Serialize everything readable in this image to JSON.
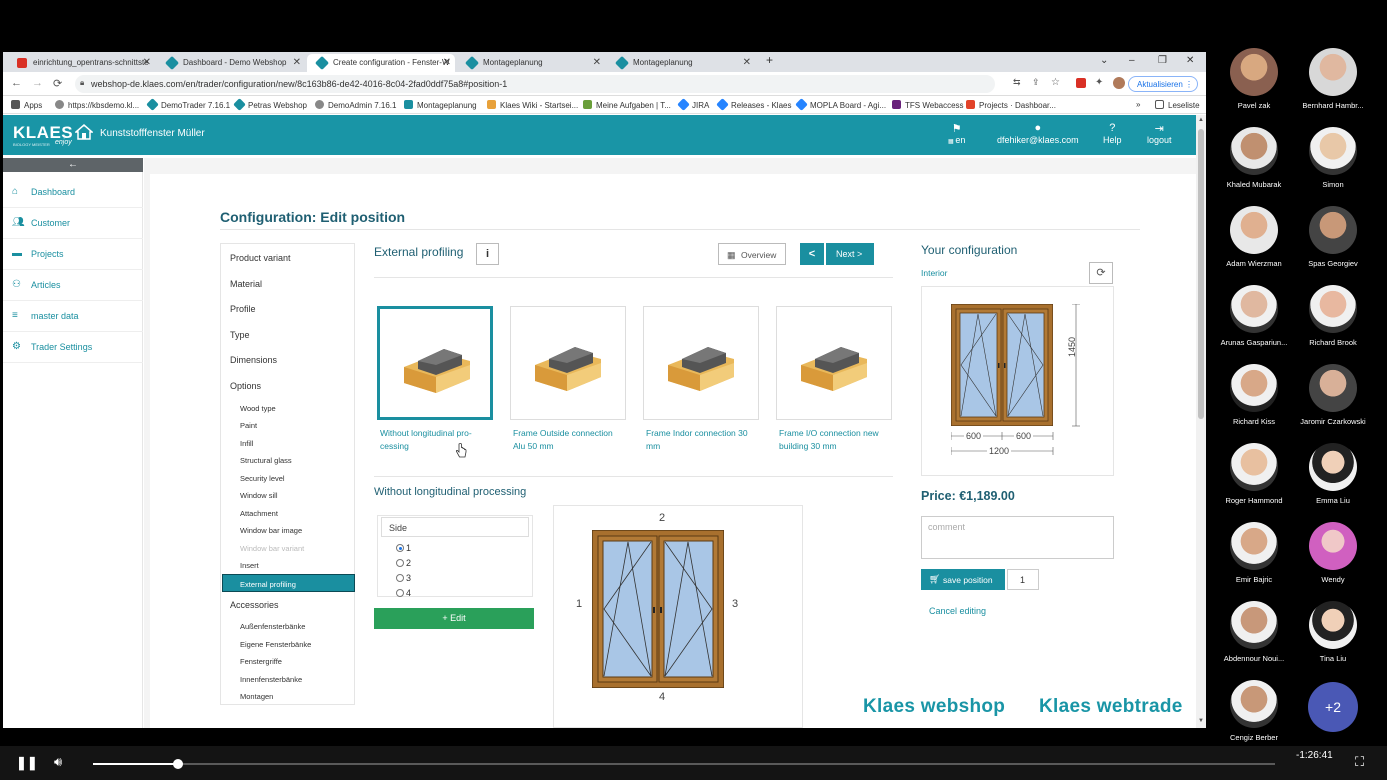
{
  "browser": {
    "tabs": [
      {
        "label": "einrichtung_opentrans-schnittste",
        "color": "#d93025",
        "active": false
      },
      {
        "label": "Dashboard - Demo Webshop",
        "color": "#1a8fa0",
        "active": false
      },
      {
        "label": "Create configuration - Fenster-W",
        "color": "#1a8fa0",
        "active": true
      },
      {
        "label": "Montageplanung",
        "color": "#1a8fa0",
        "active": false
      },
      {
        "label": "Montageplanung",
        "color": "#1a8fa0",
        "active": false
      }
    ],
    "new_tab": "+",
    "url": "webshop-de.klaes.com/en/trader/configuration/new/8c163b86-de42-4016-8c04-2fad0ddf75a8#position-1",
    "update_button": "Aktualisieren",
    "bookmarks": [
      "Apps",
      "https://kbsdemo.kl...",
      "DemoTrader 7.16.1",
      "Petras Webshop",
      "DemoAdmin 7.16.1",
      "Montageplanung",
      "Klaes Wiki - Startsei...",
      "Meine Aufgaben | T...",
      "JIRA",
      "Releases - Klaes",
      "MOPLA Board - Agi...",
      "TFS Webaccess",
      "Projects · Dashboar..."
    ],
    "bookmarks_more": "»",
    "reading_list": "Leseliste"
  },
  "app": {
    "logo": "KLAES",
    "logo_sub": "BIOLOGY MEISTER",
    "logo_script": "enjoy",
    "shop_name": "Kunststofffenster Müller",
    "header_links": {
      "language": "en",
      "user": "dfehiker@klaes.com",
      "help": "Help",
      "logout": "logout"
    },
    "sidebar_toggle": "←",
    "sidebar": [
      "Dashboard",
      "Customer",
      "Projects",
      "Articles",
      "master data",
      "Trader Settings"
    ],
    "page_title": "Configuration: Edit position",
    "steps": {
      "product_variant": "Product variant",
      "material": "Material",
      "profile": "Profile",
      "type": "Type",
      "dimensions": "Dimensions",
      "options": "Options",
      "options_sub": [
        "Wood type",
        "Paint",
        "Infill",
        "Structural glass",
        "Security level",
        "Window sill",
        "Attachment",
        "Window bar image",
        "Window bar variant",
        "Insert",
        "External profiling"
      ],
      "accessories": "Accessories",
      "accessories_sub": [
        "Außenfensterbänke",
        "Eigene Fensterbänke",
        "Fenstergriffe",
        "Innenfensterbänke",
        "Montagen"
      ]
    },
    "section_title": "External profiling",
    "info_button": "i",
    "overview_button": "Overview",
    "prev_button": "<",
    "next_button": "Next >",
    "options": [
      {
        "label_1": "Without longitudinal pro-",
        "label_2": "cessing",
        "selected": true
      },
      {
        "label_1": "Frame Outside connection",
        "label_2": "Alu 50 mm",
        "selected": false
      },
      {
        "label_1": "Frame Indor connection 30",
        "label_2": "mm",
        "selected": false
      },
      {
        "label_1": "Frame I/O connection new",
        "label_2": "building 30 mm",
        "selected": false
      }
    ],
    "subsection_title": "Without longitudinal processing",
    "side_header": "Side",
    "sides": [
      "1",
      "2",
      "3",
      "4"
    ],
    "selected_side": "1",
    "edit_button": "+ Edit",
    "side_labels": {
      "top": "2",
      "left": "1",
      "right": "3",
      "bottom": "4"
    },
    "config": {
      "title": "Your configuration",
      "view": "Interior",
      "refresh_icon": "⟳",
      "height": "1450",
      "width_left": "600",
      "width_right": "600",
      "width_total": "1200",
      "price": "Price: €1,189.00",
      "comment_placeholder": "comment",
      "save_button": "save position",
      "quantity": "1",
      "cancel": "Cancel editing"
    },
    "watermark_left": "Klaes webshop",
    "watermark_right": "Klaes webtrade"
  },
  "meeting": {
    "participants": [
      "Pavel zak",
      "Bernhard Hambr...",
      "Khaled Mubarak",
      "Simon",
      "Adam Wierzman",
      "Spas Georgiev",
      "Arunas Gaspariun...",
      "Richard Brook",
      "Richard Kiss",
      "Jaromir Czarkowski",
      "Roger Hammond",
      "Emma Liu",
      "Emir Bajric",
      "Wendy",
      "Abdennour Noui...",
      "Tina Liu",
      "Cengiz Berber"
    ],
    "more": "+2"
  },
  "player": {
    "time_left": "-1:26:41",
    "progress": 0.072
  },
  "colors": {
    "brand": "#1995a6",
    "accent": "#1a8fa0",
    "title": "#1f5f72",
    "edit_green": "#2aa05a"
  }
}
